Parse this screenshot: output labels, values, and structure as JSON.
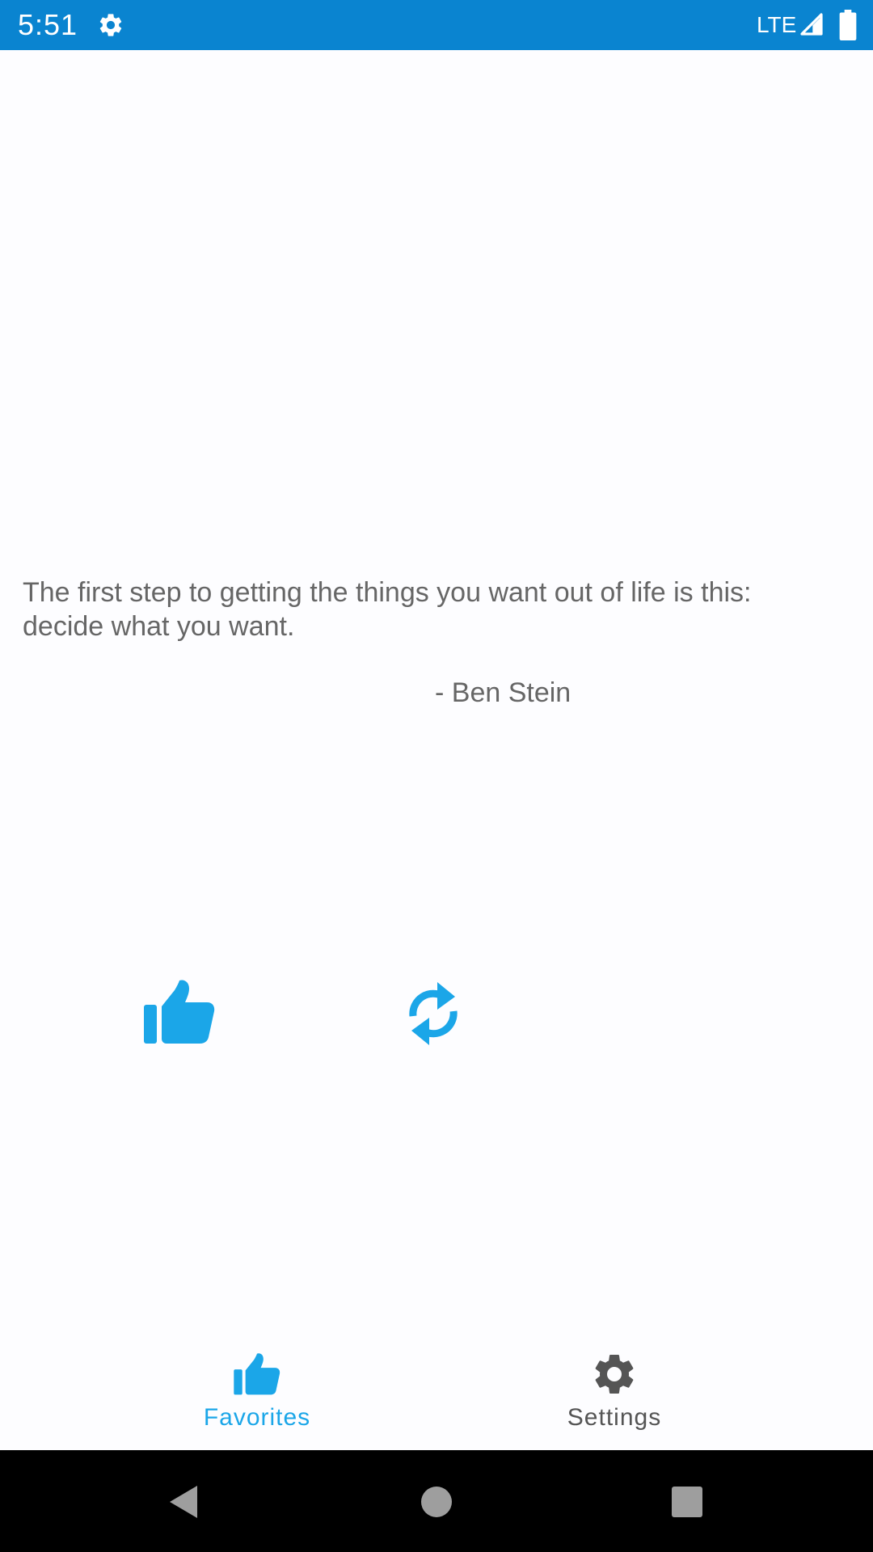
{
  "status_bar": {
    "time": "5:51",
    "network": "LTE",
    "background_color": "#0a84d0",
    "icons": [
      "gear-icon",
      "signal-icon",
      "battery-icon"
    ]
  },
  "quote": {
    "text": "The first step to getting the things you want out of life is this: decide what you want.",
    "author": "- Ben Stein"
  },
  "actions": {
    "like_icon": "thumbs-up-icon",
    "refresh_icon": "refresh-icon",
    "accent_color": "#1ba6e8"
  },
  "bottom_nav": {
    "items": [
      {
        "label": "Favorites",
        "icon": "thumbs-up-icon",
        "active": true,
        "color": "#1ba6e8"
      },
      {
        "label": "Settings",
        "icon": "gear-icon",
        "active": false,
        "color": "#555555"
      }
    ]
  },
  "system_nav": {
    "buttons": [
      "back-icon",
      "home-icon",
      "recents-icon"
    ]
  }
}
